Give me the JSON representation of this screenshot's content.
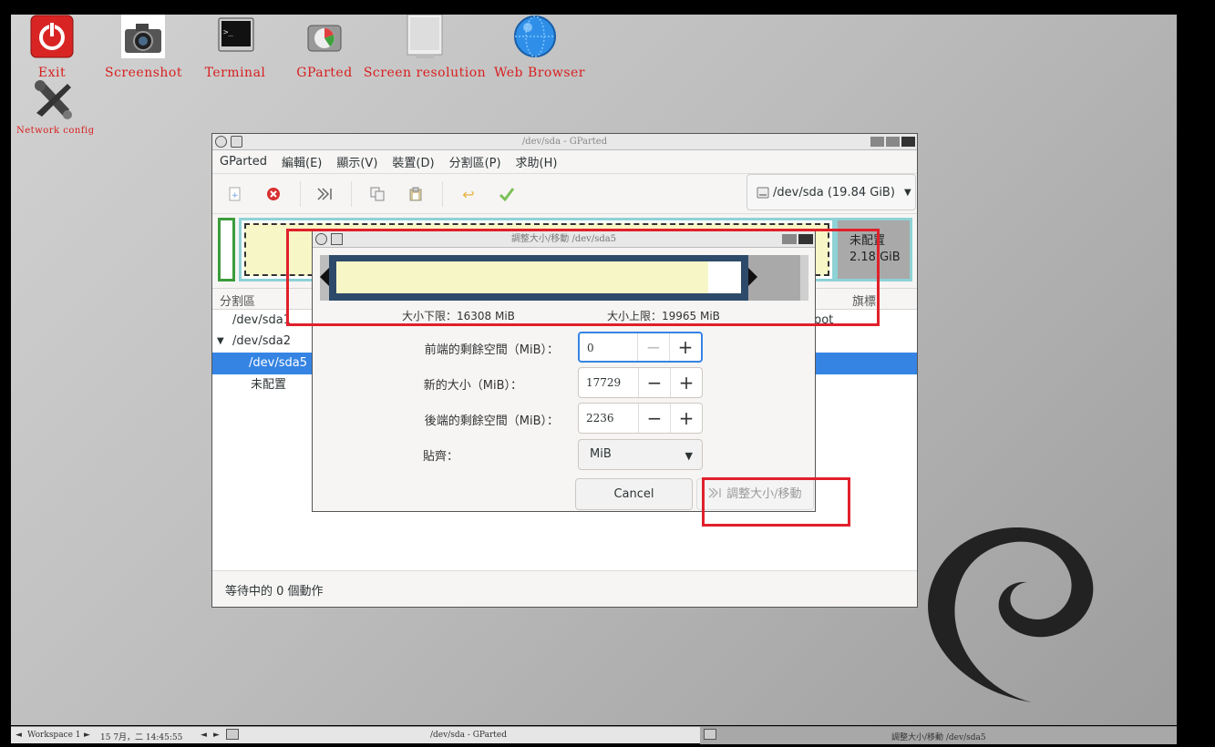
{
  "desktop": {
    "icons": [
      {
        "label": "Exit",
        "icon": "power-icon"
      },
      {
        "label": "Screenshot",
        "icon": "camera-icon"
      },
      {
        "label": "Terminal",
        "icon": "terminal-icon"
      },
      {
        "label": "GParted",
        "icon": "gparted-icon"
      },
      {
        "label": "Screen resolution",
        "icon": "monitor-icon"
      },
      {
        "label": "Web Browser",
        "icon": "globe-icon"
      },
      {
        "label": "Network config",
        "icon": "tools-icon"
      }
    ]
  },
  "main_window": {
    "title": "/dev/sda - GParted",
    "menu": [
      "GParted",
      "編輯(E)",
      "顯示(V)",
      "裝置(D)",
      "分割區(P)",
      "求助(H)"
    ],
    "device": "/dev/sda (19.84 GiB)",
    "unallocated": {
      "label": "未配置",
      "size": "2.18 GiB"
    },
    "columns": {
      "partition": "分割區",
      "flags": "旗標"
    },
    "rows": [
      {
        "name": "/dev/sda1",
        "flags": "boot"
      },
      {
        "name": "/dev/sda2"
      },
      {
        "name": "/dev/sda5"
      },
      {
        "name": "未配置"
      }
    ],
    "status": "等待中的 0 個動作"
  },
  "dialog": {
    "title": "調整大小/移動 /dev/sda5",
    "min_size": "大小下限：16308  MiB",
    "max_size": "大小上限：19965  MiB",
    "fields": {
      "free_before": {
        "label": "前端的剩餘空間（MiB）：",
        "value": "0"
      },
      "new_size": {
        "label": "新的大小（MiB）：",
        "value": "17729"
      },
      "free_after": {
        "label": "後端的剩餘空間（MiB）：",
        "value": "2236"
      },
      "align": {
        "label": "貼齊：",
        "value": "MiB"
      }
    },
    "cancel": "Cancel",
    "apply": "調整大小/移動",
    "bar": {
      "used_fraction": 0.76,
      "free_fraction": 0.07,
      "unalloc_fraction": 0.11
    }
  },
  "taskbar": {
    "workspace": "Workspace 1",
    "datetime": "15 7月，二 14:45:55",
    "task1": "/dev/sda - GParted",
    "task2": "調整大小/移動 /dev/sda5"
  },
  "colors": {
    "accent": "#3584e4",
    "highlight": "#e0202a",
    "partition_used": "#f6f6c7"
  }
}
